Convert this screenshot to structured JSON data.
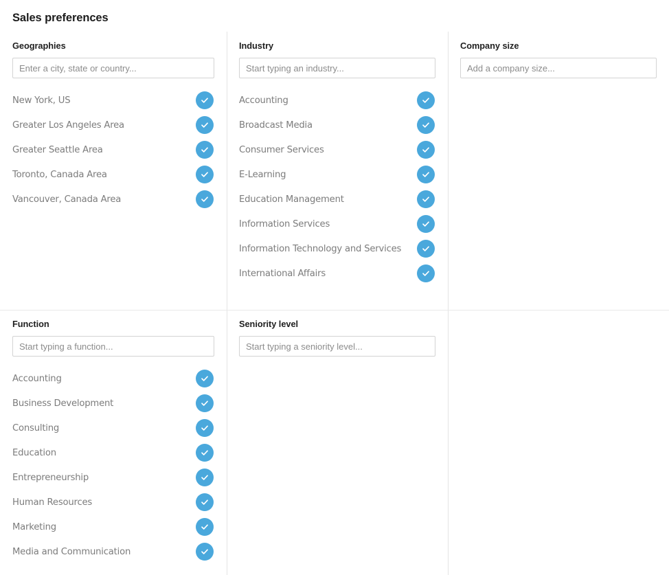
{
  "header": {
    "title": "Sales preferences"
  },
  "colors": {
    "accent": "#4aa8dc",
    "divider": "#e4e4e4",
    "input_border": "#d3d3d3",
    "label_text": "#7c7c7c",
    "heading_text": "#1f1f1f",
    "placeholder_text": "#8c8c8c"
  },
  "icons": {
    "check": "check-icon"
  },
  "facets": [
    {
      "id": "geographies",
      "title": "Geographies",
      "input_placeholder": "Enter a city, state or country...",
      "input_value": "",
      "options": [
        {
          "label": "New York, US",
          "selected": true
        },
        {
          "label": "Greater Los Angeles Area",
          "selected": true
        },
        {
          "label": "Greater Seattle Area",
          "selected": true
        },
        {
          "label": "Toronto, Canada Area",
          "selected": true
        },
        {
          "label": "Vancouver, Canada Area",
          "selected": true
        }
      ]
    },
    {
      "id": "industry",
      "title": "Industry",
      "input_placeholder": "Start typing an industry...",
      "input_value": "",
      "options": [
        {
          "label": "Accounting",
          "selected": true
        },
        {
          "label": "Broadcast Media",
          "selected": true
        },
        {
          "label": "Consumer Services",
          "selected": true
        },
        {
          "label": "E-Learning",
          "selected": true
        },
        {
          "label": "Education Management",
          "selected": true
        },
        {
          "label": "Information Services",
          "selected": true
        },
        {
          "label": "Information Technology and Services",
          "selected": true
        },
        {
          "label": "International Affairs",
          "selected": true
        }
      ]
    },
    {
      "id": "company-size",
      "title": "Company size",
      "input_placeholder": "Add a company size...",
      "input_value": "",
      "options": []
    },
    {
      "id": "function",
      "title": "Function",
      "input_placeholder": "Start typing a function...",
      "input_value": "",
      "options": [
        {
          "label": "Accounting",
          "selected": true
        },
        {
          "label": "Business Development",
          "selected": true
        },
        {
          "label": "Consulting",
          "selected": true
        },
        {
          "label": "Education",
          "selected": true
        },
        {
          "label": "Entrepreneurship",
          "selected": true
        },
        {
          "label": "Human Resources",
          "selected": true
        },
        {
          "label": "Marketing",
          "selected": true
        },
        {
          "label": "Media and Communication",
          "selected": true
        }
      ]
    },
    {
      "id": "seniority-level",
      "title": "Seniority level",
      "input_placeholder": "Start typing a seniority level...",
      "input_value": "",
      "options": []
    },
    {
      "id": "empty-cell",
      "title": "",
      "input_placeholder": "",
      "input_value": "",
      "options": []
    }
  ]
}
